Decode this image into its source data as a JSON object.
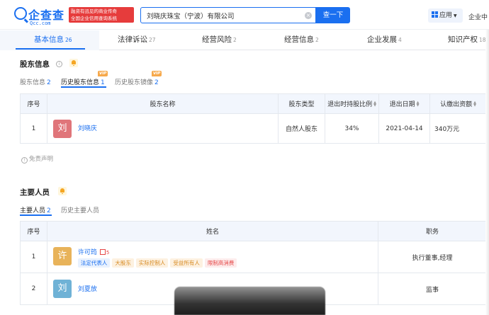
{
  "brand": {
    "name": "企查查",
    "domain": "Qcc.com",
    "badge_line1": "融资有迅见的商业传奇",
    "badge_line2": "全国企业信用查询系统"
  },
  "search": {
    "value": "刘晓庆珠宝（宁波）有限公司",
    "button_label": "查一下",
    "clear_glyph": "×"
  },
  "header": {
    "apps_label": "应用",
    "enterprise_label": "企业中"
  },
  "tabs": [
    {
      "label": "基本信息",
      "count": "26"
    },
    {
      "label": "法律诉讼",
      "count": "27"
    },
    {
      "label": "经营风险",
      "count": "2"
    },
    {
      "label": "经营信息",
      "count": "2"
    },
    {
      "label": "企业发展",
      "count": "4"
    },
    {
      "label": "知识产权",
      "count": "18"
    }
  ],
  "shareholders": {
    "title": "股东信息",
    "subtabs": [
      {
        "label": "股东信息",
        "count": "2"
      },
      {
        "label": "历史股东信息",
        "count": "1",
        "vip": "VIP"
      },
      {
        "label": "历史股东镜像",
        "count": "2",
        "vip": "VIP"
      }
    ],
    "columns": [
      "序号",
      "股东名称",
      "股东类型",
      "退出时持股比例",
      "退出日期",
      "认缴出资额"
    ],
    "rows": [
      {
        "index": "1",
        "avatar": "刘",
        "name": "刘晓庆",
        "type": "自然人股东",
        "ratio": "34%",
        "date": "2021-04-14",
        "amount": "340万元"
      }
    ],
    "disclaimer": "免责声明",
    "disclaimer_glyph": "!"
  },
  "personnel": {
    "title": "主要人员",
    "subtabs": [
      {
        "label": "主要人员",
        "count": "2"
      },
      {
        "label": "历史主要人员",
        "count": ""
      }
    ],
    "columns": [
      "序号",
      "姓名",
      "职务"
    ],
    "rows": [
      {
        "index": "1",
        "avatar": "许",
        "name": "许可筠",
        "relation_count": "5",
        "tags": [
          {
            "label": "法定代表人",
            "style": "blue"
          },
          {
            "label": "大股东",
            "style": "yellow"
          },
          {
            "label": "实际控制人",
            "style": "yellow"
          },
          {
            "label": "受益所有人",
            "style": "yellow"
          },
          {
            "label": "限制高消费",
            "style": "red"
          }
        ],
        "position": "执行董事,经理"
      },
      {
        "index": "2",
        "avatar": "刘",
        "name": "刘夏放",
        "relation_count": "",
        "tags": [],
        "position": "监事"
      }
    ]
  },
  "colors": {
    "accent": "#1a6ff0",
    "avatar_liu": "#e0757a",
    "avatar_xu": "#e8b35a",
    "avatar_liu2": "#6fb2d6"
  }
}
